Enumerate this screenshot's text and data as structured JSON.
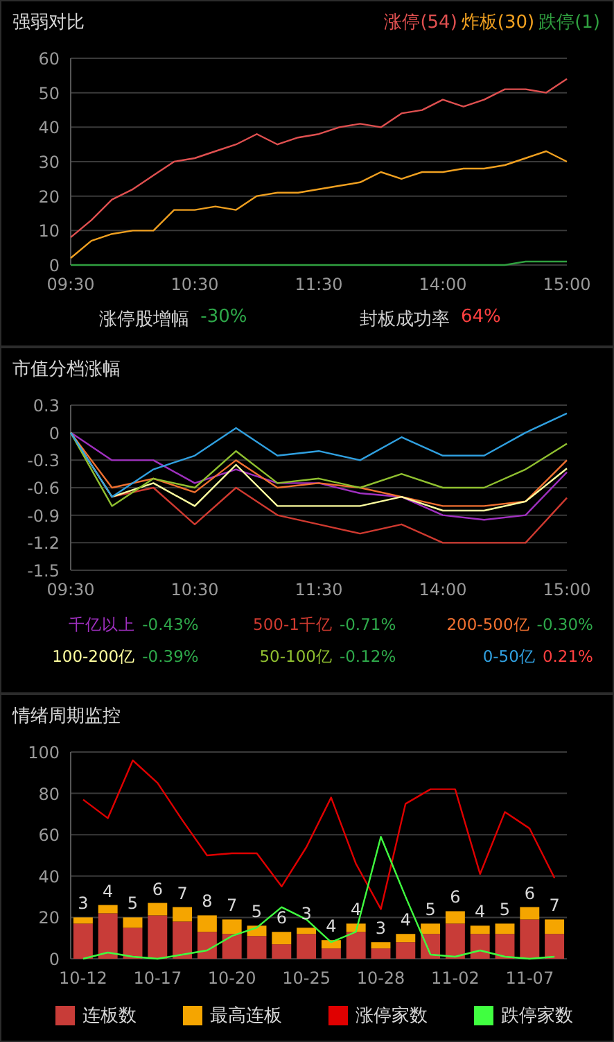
{
  "panels": [
    {
      "title": "强弱对比",
      "legend": [
        {
          "label": "涨停(54)",
          "color": "#e05050"
        },
        {
          "label": "炸板(30)",
          "color": "#f0a020"
        },
        {
          "label": "跌停(1)",
          "color": "#30a040"
        }
      ],
      "chart_data": {
        "type": "line",
        "categories": [
          "09:30",
          null,
          null,
          null,
          null,
          null,
          "10:30",
          null,
          null,
          null,
          null,
          null,
          "11:30",
          null,
          null,
          null,
          null,
          null,
          "14:00",
          null,
          null,
          null,
          null,
          null,
          "15:00"
        ],
        "ylim": [
          0,
          60
        ],
        "grid": true,
        "yticks": [
          0,
          10,
          20,
          30,
          40,
          50,
          60
        ],
        "series": [
          {
            "color": "#e05050",
            "values": [
              8,
              13,
              19,
              22,
              26,
              30,
              31,
              33,
              35,
              38,
              35,
              37,
              38,
              40,
              41,
              40,
              44,
              45,
              48,
              46,
              48,
              51,
              51,
              50,
              54
            ]
          },
          {
            "color": "#f0a020",
            "values": [
              2,
              7,
              9,
              10,
              10,
              16,
              16,
              17,
              16,
              20,
              21,
              21,
              22,
              23,
              24,
              27,
              25,
              27,
              27,
              28,
              28,
              29,
              31,
              33,
              30
            ]
          },
          {
            "color": "#30a040",
            "values": [
              0,
              0,
              0,
              0,
              0,
              0,
              0,
              0,
              0,
              0,
              0,
              0,
              0,
              0,
              0,
              0,
              0,
              0,
              0,
              0,
              0,
              0,
              1,
              1,
              1
            ]
          }
        ]
      },
      "stats": [
        {
          "label": "涨停股增幅",
          "value": "-30%",
          "color": "#2ea84a"
        },
        {
          "label": "封板成功率",
          "value": "64%",
          "color": "#ff4040"
        }
      ]
    },
    {
      "title": "市值分档涨幅",
      "chart_data": {
        "type": "line",
        "categories": [
          "09:30",
          null,
          null,
          "10:30",
          null,
          null,
          "11:30",
          null,
          null,
          "14:00",
          null,
          null,
          "15:00"
        ],
        "ylim": [
          -1.5,
          0.3
        ],
        "grid": true,
        "yticks": [
          0.3,
          0,
          -0.3,
          -0.6,
          -0.9,
          -1.2,
          -1.5
        ],
        "series": [
          {
            "color": "#a030c0",
            "values": [
              0,
              -0.3,
              -0.3,
              -0.55,
              -0.4,
              -0.55,
              -0.55,
              -0.66,
              -0.7,
              -0.9,
              -0.95,
              -0.9,
              -0.43
            ]
          },
          {
            "color": "#d03a30",
            "values": [
              0,
              -0.7,
              -0.6,
              -1.0,
              -0.6,
              -0.9,
              -1.0,
              -1.1,
              -1.0,
              -1.2,
              -1.2,
              -1.2,
              -0.71
            ]
          },
          {
            "color": "#f07030",
            "values": [
              0,
              -0.6,
              -0.5,
              -0.65,
              -0.3,
              -0.6,
              -0.55,
              -0.6,
              -0.7,
              -0.8,
              -0.8,
              -0.75,
              -0.3
            ]
          },
          {
            "color": "#ffffa0",
            "values": [
              0,
              -0.7,
              -0.55,
              -0.8,
              -0.35,
              -0.8,
              -0.8,
              -0.8,
              -0.7,
              -0.85,
              -0.85,
              -0.75,
              -0.39
            ]
          },
          {
            "color": "#90c030",
            "values": [
              0,
              -0.8,
              -0.5,
              -0.6,
              -0.2,
              -0.55,
              -0.5,
              -0.6,
              -0.45,
              -0.6,
              -0.6,
              -0.4,
              -0.12
            ]
          },
          {
            "color": "#30a0e0",
            "values": [
              0,
              -0.7,
              -0.4,
              -0.25,
              0.05,
              -0.25,
              -0.2,
              -0.3,
              -0.05,
              -0.25,
              -0.25,
              0,
              0.21
            ]
          }
        ]
      },
      "legend": [
        {
          "label": "千亿以上",
          "value": "-0.43%",
          "color": "#2ea84a"
        },
        {
          "label": "500-1千亿",
          "value": "-0.71%",
          "color": "#2ea84a"
        },
        {
          "label": "200-500亿",
          "value": "-0.30%",
          "color": "#2ea84a"
        },
        {
          "label": "100-200亿",
          "value": "-0.39%",
          "color": "#2ea84a"
        },
        {
          "label": "50-100亿",
          "value": "-0.12%",
          "color": "#2ea84a"
        },
        {
          "label": "0-50亿",
          "value": "0.21%",
          "color": "#ff4040"
        }
      ]
    },
    {
      "title": "情绪周期监控",
      "chart_data": {
        "type": "bar",
        "stacked": true,
        "categories": [
          "10-12",
          null,
          null,
          "10-17",
          null,
          null,
          "10-20",
          null,
          null,
          "10-25",
          null,
          null,
          "10-28",
          null,
          null,
          "11-02",
          null,
          null,
          "11-07",
          null
        ],
        "ylim": [
          0,
          100
        ],
        "grid": true,
        "yticks": [
          0,
          20,
          40,
          60,
          80,
          100
        ],
        "value_labels": [
          "3",
          "4",
          "5",
          "6",
          "7",
          "8",
          "7",
          "5",
          "6",
          "3",
          "4",
          "4",
          "3",
          "4",
          "5",
          "6",
          "4",
          "5",
          "6",
          "7"
        ],
        "series": [
          {
            "name": "连板数",
            "type": "bar",
            "color": "#c83c38",
            "values": [
              17,
              22,
              15,
              21,
              18,
              13,
              12,
              11,
              7,
              12,
              5,
              13,
              5,
              8,
              12,
              17,
              12,
              12,
              19,
              12
            ]
          },
          {
            "name": "最高连板",
            "type": "bar",
            "color": "#f5a500",
            "values": [
              3,
              4,
              5,
              6,
              7,
              8,
              7,
              5,
              6,
              3,
              4,
              4,
              3,
              4,
              5,
              6,
              4,
              5,
              6,
              7
            ]
          },
          {
            "name": "涨停家数",
            "type": "line",
            "color": "#e00000",
            "values": [
              77,
              68,
              96,
              85,
              67,
              50,
              51,
              51,
              35,
              54,
              78,
              46,
              24,
              75,
              82,
              82,
              41,
              71,
              63,
              39
            ]
          },
          {
            "name": "跌停家数",
            "type": "line",
            "color": "#40ff40",
            "values": [
              0,
              3,
              1,
              0,
              2,
              4,
              11,
              15,
              25,
              19,
              8,
              13,
              59,
              30,
              2,
              1,
              4,
              1,
              0,
              1
            ]
          }
        ]
      }
    }
  ]
}
